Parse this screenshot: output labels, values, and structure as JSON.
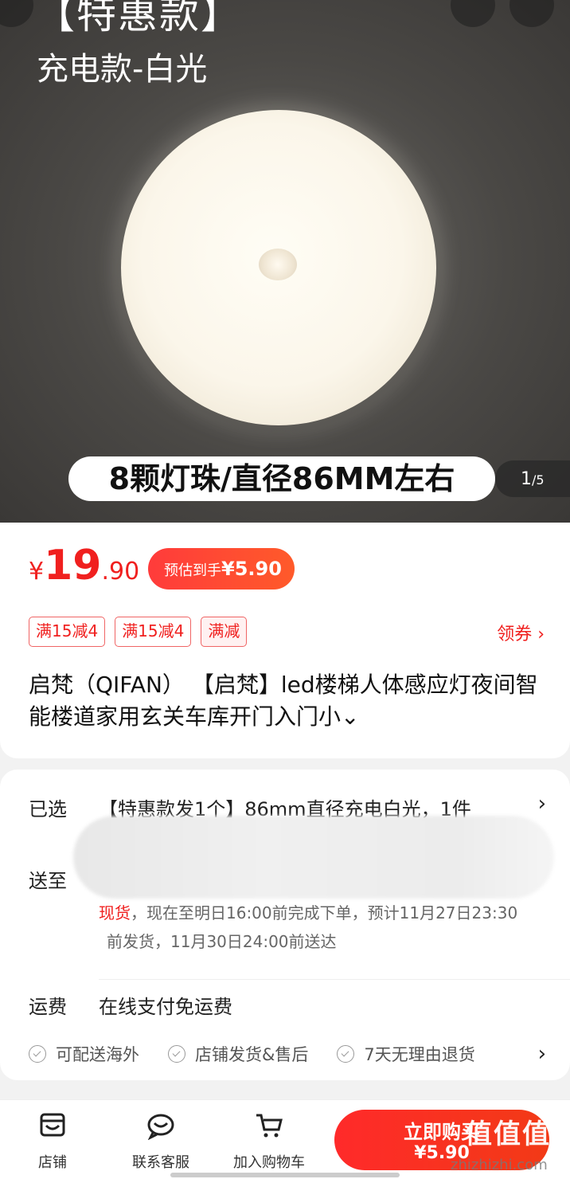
{
  "hero": {
    "tag": "【特惠款】",
    "subtitle": "充电款-白光",
    "caption": "8颗灯珠/直径86MM左右",
    "counter_current": "1",
    "counter_total": "/5"
  },
  "price": {
    "symbol": "¥",
    "integer": "19",
    "decimal": ".90",
    "estimate_label": "预估到手",
    "estimate_value": "¥5.90"
  },
  "coupons": [
    "满15减4",
    "满15减4",
    "满减"
  ],
  "get_coupon": "领券 ›",
  "product_title": "启梵（QIFAN） 【启梵】led楼梯人体感应灯夜间智能楼道家用玄关车库开门入门小⌄",
  "options": {
    "selected_label": "已选",
    "selected_value": "【特惠款发1个】86mm直径充电白光，1件",
    "ship_to_label": "送至",
    "delivery_line1_highlight": "现货",
    "delivery_line1_rest": "，现在至明日16:00前完成下单，预计11月27日23:30",
    "delivery_line2": "前发货，11月30日24:00前送达",
    "freight_label": "运费",
    "freight_value": "在线支付免运费",
    "chevron": "›"
  },
  "services": [
    "可配送海外",
    "店铺发货&售后",
    "7天无理由退货"
  ],
  "bottom_bar": {
    "store": "店铺",
    "service": "联系客服",
    "cart": "加入购物车",
    "buy_label": "立即购买",
    "buy_price": "¥5.90"
  },
  "watermark": {
    "text": "值值值",
    "sub": "zhizhizhi.com"
  },
  "colors": {
    "accent": "#f0201f",
    "badge_gradient_start": "#ff3b3b",
    "badge_gradient_end": "#ff5a2a"
  }
}
